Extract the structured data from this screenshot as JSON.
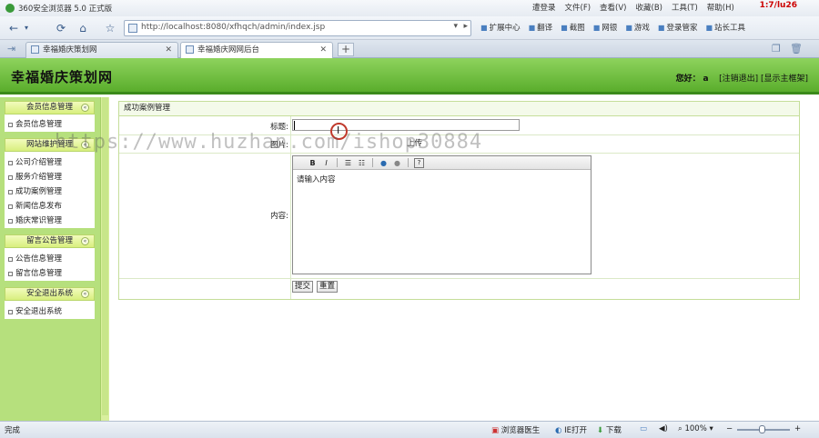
{
  "browser": {
    "title": "360安全浏览器 5.0 正式版",
    "menus": [
      "遭登录",
      "文件(F)",
      "查看(V)",
      "收藏(B)",
      "工具(T)",
      "帮助(H)"
    ],
    "clock": "1:7/lu26",
    "url": "http://localhost:8080/xfhqch/admin/index.jsp",
    "toolbar": [
      "扩展中心",
      "翻译",
      "截图",
      "网银",
      "游戏",
      "登录管家",
      "站长工具"
    ],
    "tabs": [
      {
        "label": "幸福婚庆策划网",
        "active": false
      },
      {
        "label": "幸福婚庆网网后台",
        "active": true
      }
    ],
    "status": {
      "text": "完成",
      "items": [
        "浏览器医生",
        "IE打开",
        "下载",
        "100%"
      ]
    }
  },
  "header": {
    "site_title": "幸福婚庆策划网",
    "greeting_prefix": "您好：",
    "user": "a",
    "logout": "[注销退出]",
    "home": "[显示主框架]"
  },
  "sidebar": {
    "groups": [
      {
        "title": "会员信息管理",
        "items": [
          "会员信息管理"
        ]
      },
      {
        "title": "网站维护管理",
        "items": [
          "公司介绍管理",
          "服务介绍管理",
          "成功案例管理",
          "新闻信息发布",
          "婚庆常识管理"
        ]
      },
      {
        "title": "留言公告管理",
        "items": [
          "公告信息管理",
          "留言信息管理"
        ]
      },
      {
        "title": "安全退出系统",
        "items": [
          "安全退出系统"
        ]
      }
    ]
  },
  "form": {
    "heading": "成功案例管理",
    "title_label": "标题:",
    "image_label": "图片:",
    "upload_label": "上传",
    "content_label": "内容:",
    "editor_placeholder": "请输入内容",
    "submit": "提交",
    "reset": "重置"
  },
  "watermark": "https://www.huzhan.com/ishop30884"
}
